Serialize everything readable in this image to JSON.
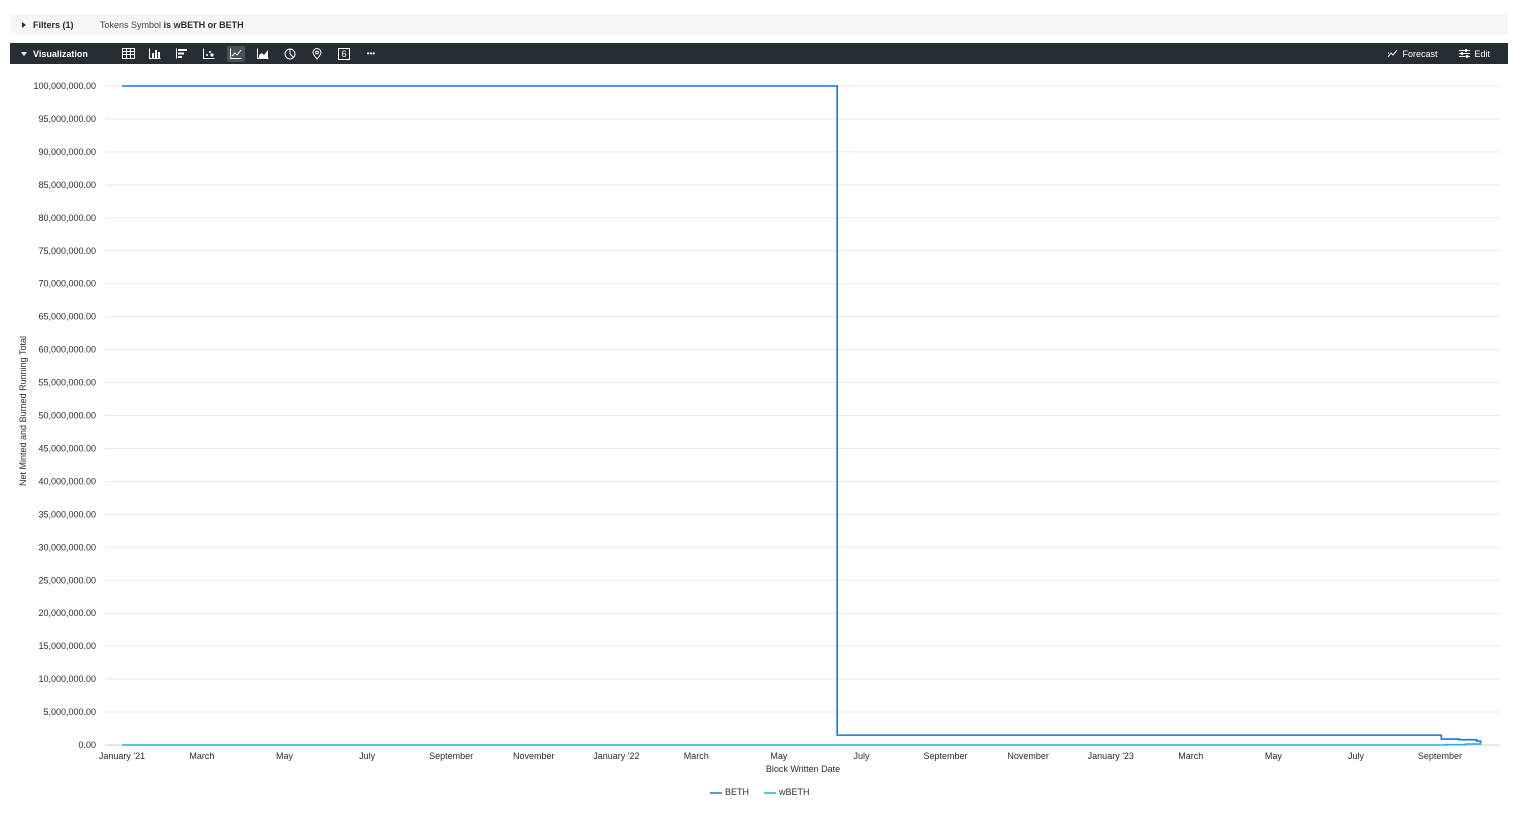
{
  "filters": {
    "label": "Filters (1)",
    "field": "Tokens Symbol",
    "operator": "is",
    "value": "wBETH or BETH"
  },
  "toolbar": {
    "title": "Visualization",
    "icons": [
      "table-icon",
      "column-chart-icon",
      "bar-chart-icon",
      "scatter-chart-icon",
      "line-chart-icon",
      "area-chart-icon",
      "pie-chart-icon",
      "map-pin-icon",
      "single-value-icon",
      "more-icon"
    ],
    "single_value_glyph": "6",
    "more_glyph": "•••",
    "forecast_label": "Forecast",
    "edit_label": "Edit",
    "colors": {
      "bar_bg": "#262d33",
      "active_bg": "#4a5259"
    }
  },
  "chart_data": {
    "type": "line",
    "xlabel": "Block Written Date",
    "ylabel": "Net Minted and Burned Running Total",
    "ylim": [
      0,
      100000000
    ],
    "yticks": [
      "0.00",
      "5,000,000.00",
      "10,000,000.00",
      "15,000,000.00",
      "20,000,000.00",
      "25,000,000.00",
      "30,000,000.00",
      "35,000,000.00",
      "40,000,000.00",
      "45,000,000.00",
      "50,000,000.00",
      "55,000,000.00",
      "60,000,000.00",
      "65,000,000.00",
      "70,000,000.00",
      "75,000,000.00",
      "80,000,000.00",
      "85,000,000.00",
      "90,000,000.00",
      "95,000,000.00",
      "100,000,000.00"
    ],
    "xlim": [
      "2021-01-01",
      "2023-10-05"
    ],
    "xticks": [
      {
        "date": "2021-01-01",
        "label": "January '21"
      },
      {
        "date": "2021-03-01",
        "label": "March"
      },
      {
        "date": "2021-05-01",
        "label": "May"
      },
      {
        "date": "2021-07-01",
        "label": "July"
      },
      {
        "date": "2021-09-01",
        "label": "September"
      },
      {
        "date": "2021-11-01",
        "label": "November"
      },
      {
        "date": "2022-01-01",
        "label": "January '22"
      },
      {
        "date": "2022-03-01",
        "label": "March"
      },
      {
        "date": "2022-05-01",
        "label": "May"
      },
      {
        "date": "2022-07-01",
        "label": "July"
      },
      {
        "date": "2022-09-01",
        "label": "September"
      },
      {
        "date": "2022-11-01",
        "label": "November"
      },
      {
        "date": "2023-01-01",
        "label": "January '23"
      },
      {
        "date": "2023-03-01",
        "label": "March"
      },
      {
        "date": "2023-05-01",
        "label": "May"
      },
      {
        "date": "2023-07-01",
        "label": "July"
      },
      {
        "date": "2023-09-01",
        "label": "September"
      }
    ],
    "grid": true,
    "legend_position": "bottom-center",
    "series": [
      {
        "name": "BETH",
        "color": "#1a73d9",
        "step": true,
        "points": [
          {
            "x": "2021-01-01",
            "y": 100000000
          },
          {
            "x": "2022-06-12",
            "y": 100000000
          },
          {
            "x": "2022-06-13",
            "y": 1500000
          },
          {
            "x": "2023-09-01",
            "y": 1500000
          },
          {
            "x": "2023-09-02",
            "y": 900000
          },
          {
            "x": "2023-09-15",
            "y": 800000
          },
          {
            "x": "2023-09-28",
            "y": 600000
          },
          {
            "x": "2023-10-01",
            "y": 150000
          }
        ]
      },
      {
        "name": "wBETH",
        "color": "#2eaadc",
        "step": true,
        "points": [
          {
            "x": "2021-01-01",
            "y": 0
          },
          {
            "x": "2023-08-15",
            "y": 0
          },
          {
            "x": "2023-09-05",
            "y": 50000
          },
          {
            "x": "2023-09-20",
            "y": 150000
          },
          {
            "x": "2023-10-01",
            "y": 400000
          }
        ]
      }
    ]
  }
}
